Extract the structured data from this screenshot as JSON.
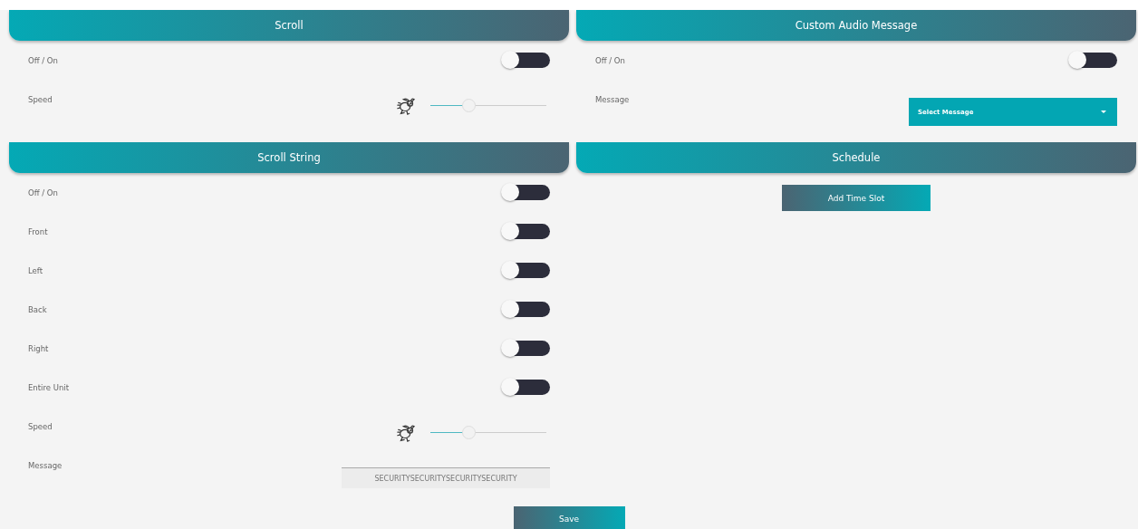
{
  "left_column": [
    {
      "title": "Scroll",
      "rows": [
        {
          "kind": "toggle",
          "label": "Off / On",
          "on": false
        },
        {
          "kind": "slider",
          "label": "Speed",
          "level": 0.3
        }
      ]
    },
    {
      "title": "Scroll String",
      "rows": [
        {
          "kind": "toggle",
          "label": "Off / On",
          "on": false
        },
        {
          "kind": "toggle",
          "label": "Front",
          "on": false
        },
        {
          "kind": "toggle",
          "label": "Left",
          "on": false
        },
        {
          "kind": "toggle",
          "label": "Back",
          "on": false
        },
        {
          "kind": "toggle",
          "label": "Right",
          "on": false
        },
        {
          "kind": "toggle",
          "label": "Entire Unit",
          "on": false
        },
        {
          "kind": "slider",
          "label": "Speed",
          "level": 0.3
        },
        {
          "kind": "text",
          "label": "Message",
          "value": "SECURITYSECURITYSECURITYSECURITY"
        }
      ]
    }
  ],
  "right_column": [
    {
      "title": "Custom Audio Message",
      "rows": [
        {
          "kind": "toggle",
          "label": "Off / On",
          "on": false
        },
        {
          "kind": "dropdown",
          "label": "Message",
          "value": "Select Message"
        }
      ]
    },
    {
      "title": "Schedule",
      "rows": [
        {
          "kind": "button",
          "label": "Add Time Slot"
        }
      ]
    }
  ],
  "save_button": {
    "label": "Save"
  }
}
